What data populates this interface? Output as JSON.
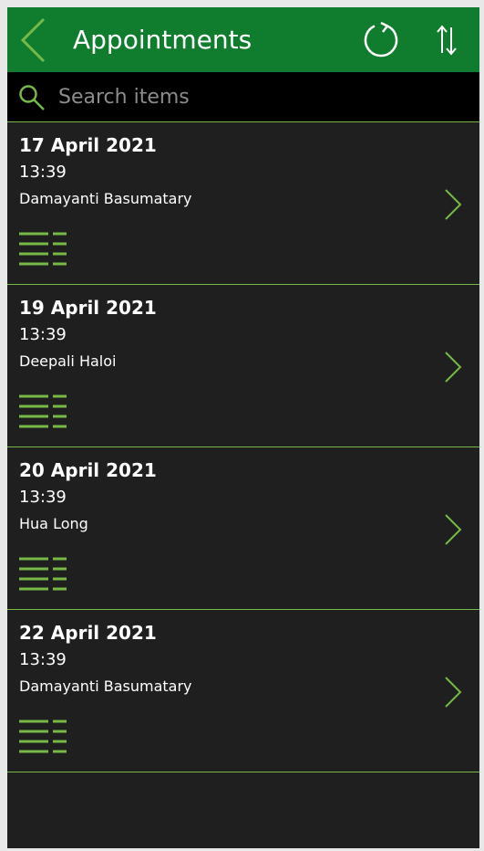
{
  "header": {
    "title": "Appointments",
    "back_icon": "chevron-left-icon",
    "refresh_icon": "refresh-icon",
    "sort_icon": "sort-icon"
  },
  "search": {
    "placeholder": "Search items",
    "value": "",
    "icon": "search-icon"
  },
  "appointments": [
    {
      "date": "17 April 2021",
      "time": "13:39",
      "name": "Damayanti Basumatary"
    },
    {
      "date": "19 April 2021",
      "time": "13:39",
      "name": "Deepali Haloi"
    },
    {
      "date": "20 April 2021",
      "time": "13:39",
      "name": "Hua Long"
    },
    {
      "date": "22 April 2021",
      "time": "13:39",
      "name": "Damayanti Basumatary"
    }
  ],
  "colors": {
    "header_bg": "#107c2e",
    "accent": "#76b947",
    "list_bg": "#1f1f1f",
    "search_bg": "#000000"
  }
}
